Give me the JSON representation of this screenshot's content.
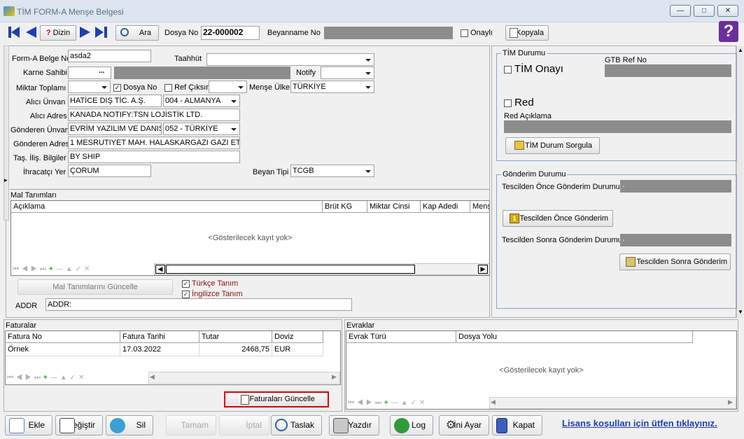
{
  "window": {
    "title": "TİM FORM-A  Menşe Belgesi"
  },
  "toolbar": {
    "dizin": "Dizin",
    "ara": "Ara",
    "dosya_no_label": "Dosya No",
    "dosya_no_value": "22-000002",
    "beyanname_no_label": "Beyanname No",
    "onayli_label": "Onaylı",
    "kopyala": "Kopyala",
    "help_glyph": "?"
  },
  "form": {
    "belge_no_label": "Form-A Belge No",
    "belge_no_value": "asda2",
    "taahhut_label": "Taahhüt",
    "karne_label": "Karne Sahibi",
    "karne_btn": "...",
    "notify_label": "Notify",
    "miktar_label": "Miktar Toplamı",
    "dosya_no_chk": "Dosya No",
    "ref_cikisin": "Ref Çıksın",
    "mense_label": "Menşe Ülke",
    "mense_value": "TÜRKİYE",
    "alici_unvan_label": "Alıcı Ünvan",
    "alici_unvan_value": "HATİCE DIŞ TİC. A.Ş.",
    "alici_ulke": "004 - ALMANYA",
    "alici_adres_label": "Alıcı Adres",
    "alici_adres_value": "KANADA   NOTIFY:TSN LOJİSTİK LTD.",
    "gonderen_unvan_label": "Gönderen Ünvan",
    "gonderen_unvan_value": "EVRİM YAZILIM VE DANIŞ",
    "gonderen_ulke": "052 - TÜRKİYE",
    "gonderen_adres_label": "Gönderen Adres",
    "gonderen_adres_value": "1 MESRUTIYET MAH. HALASKARGAZI GAZI ETH",
    "tas_label": "Taş. İliş. Bilgiler",
    "tas_value": "BY SHIP",
    "ihracatci_label": "İhracatçı Yer",
    "ihracatci_value": "ÇORUM",
    "beyan_tipi_label": "Beyan Tipi",
    "beyan_tipi_value": "TCGB"
  },
  "mal": {
    "title": "Mal Tanımları",
    "columns": [
      "Açıklama",
      "Brüt KG",
      "Miktar Cinsi",
      "Kap Adedi",
      "Menş"
    ],
    "empty": "<Gösterilecek kayıt yok>",
    "guncelle": "Mal Tanımlarını Güncelle",
    "turkce": "Türkçe Tanım",
    "ingilizce": "İngilizce Tanım",
    "addr_label": "ADDR",
    "addr_value": "ADDR:"
  },
  "tim": {
    "title": "TİM Durumu",
    "onay": "TİM Onayı",
    "gtb_label": "GTB Ref No",
    "red": "Red",
    "red_aciklama": "Red Açıklama",
    "sorgula": "TİM Durum Sorgula"
  },
  "gonderim": {
    "title": "Gönderim Durumu",
    "once_label": "Tescilden Önce Gönderim Durumu",
    "once_value": "-",
    "once_btn": "Tescilden Önce Gönderim",
    "sonra_label": "Tescilden Sonra Gönderim Durumu",
    "sonra_value": "-",
    "sonra_btn": "Tescilden Sonra Gönderim"
  },
  "faturalar": {
    "title": "Faturalar",
    "columns": [
      "Fatura No",
      "Fatura Tarihi",
      "Tutar",
      "Doviz"
    ],
    "rows": [
      [
        "Örnek",
        "17.03.2022",
        "2468,75",
        "EUR"
      ]
    ],
    "guncelle": "Faturaları Güncelle"
  },
  "evraklar": {
    "title": "Evraklar",
    "columns": [
      "Evrak Türü",
      "Dosya Yolu"
    ],
    "empty": "<Gösterilecek kayıt yok>"
  },
  "bottom": {
    "ekle": "Ekle",
    "degistir": "Değiştir",
    "sil": "Sil",
    "tamam": "Tamam",
    "iptal": "İptal",
    "taslak": "Taslak",
    "yazdir": "Yazdır",
    "log": "Log",
    "ini": "İni Ayar",
    "kapat": "Kapat",
    "lisans": "Lisans koşulları için ütfen tıklayınız."
  },
  "colors": {
    "accent": "#1f3fb0",
    "highlight_border": "#e00000",
    "help_bg": "#6b2e9c",
    "group_border": "#8aa4c8"
  }
}
